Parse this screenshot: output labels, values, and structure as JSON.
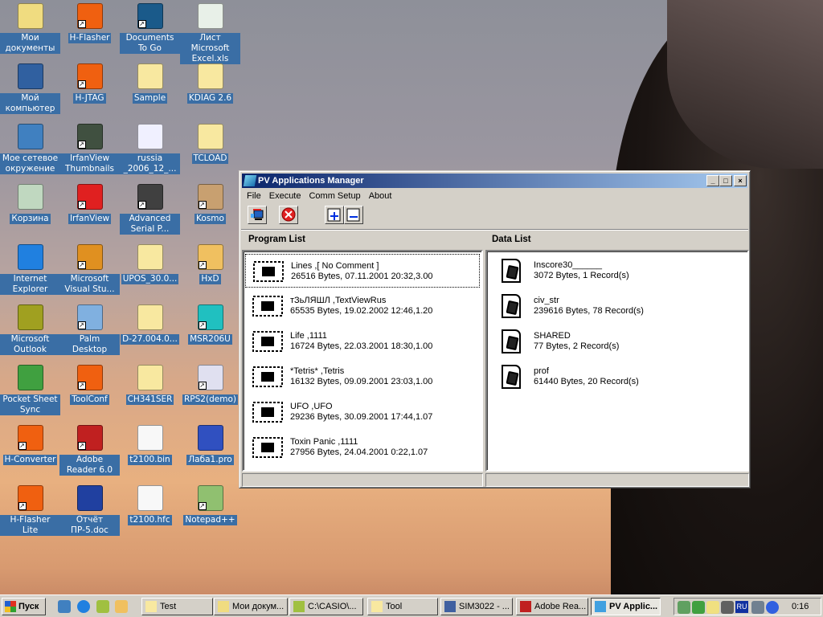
{
  "desktop_icons": [
    {
      "label": "Мои документы",
      "col": 0,
      "row": 0,
      "color": "#f0dc80",
      "shortcut": false
    },
    {
      "label": "H-Flasher",
      "col": 1,
      "row": 0,
      "color": "#f06010",
      "shortcut": true
    },
    {
      "label": "Documents To Go",
      "col": 2,
      "row": 0,
      "color": "#1a5a8a",
      "shortcut": true
    },
    {
      "label": "Лист Microsoft Excel.xls",
      "col": 3,
      "row": 0,
      "color": "#e8f0e8",
      "shortcut": false
    },
    {
      "label": "Мой компьютер",
      "col": 0,
      "row": 1,
      "color": "#3060a0",
      "shortcut": false
    },
    {
      "label": "H-JTAG",
      "col": 1,
      "row": 1,
      "color": "#f06010",
      "shortcut": true
    },
    {
      "label": "Sample",
      "col": 2,
      "row": 1,
      "color": "#f8e8a0",
      "shortcut": false
    },
    {
      "label": "KDIAG 2.6",
      "col": 3,
      "row": 1,
      "color": "#f8e8a0",
      "shortcut": false
    },
    {
      "label": "Мое сетевое окружение",
      "col": 0,
      "row": 2,
      "color": "#4080c0",
      "shortcut": false
    },
    {
      "label": "IrfanView Thumbnails",
      "col": 1,
      "row": 2,
      "color": "#405040",
      "shortcut": true
    },
    {
      "label": "russia _2006_12_...",
      "col": 2,
      "row": 2,
      "color": "#f0f0ff",
      "shortcut": false
    },
    {
      "label": "TCLOAD",
      "col": 3,
      "row": 2,
      "color": "#f8e8a0",
      "shortcut": false
    },
    {
      "label": "Корзина",
      "col": 0,
      "row": 3,
      "color": "#c0d8c0",
      "shortcut": false
    },
    {
      "label": "IrfanView",
      "col": 1,
      "row": 3,
      "color": "#e02020",
      "shortcut": true
    },
    {
      "label": "Advanced Serial P...",
      "col": 2,
      "row": 3,
      "color": "#404040",
      "shortcut": true
    },
    {
      "label": "Kosmo",
      "col": 3,
      "row": 3,
      "color": "#c8a070",
      "shortcut": true
    },
    {
      "label": "Internet Explorer",
      "col": 0,
      "row": 4,
      "color": "#2080e0",
      "shortcut": false
    },
    {
      "label": "Microsoft Visual Stu...",
      "col": 1,
      "row": 4,
      "color": "#e09020",
      "shortcut": true
    },
    {
      "label": "UPOS_30.0...",
      "col": 2,
      "row": 4,
      "color": "#f8e8a0",
      "shortcut": false
    },
    {
      "label": "HxD",
      "col": 3,
      "row": 4,
      "color": "#f0c060",
      "shortcut": true
    },
    {
      "label": "Microsoft Outlook",
      "col": 0,
      "row": 5,
      "color": "#a0a020",
      "shortcut": false
    },
    {
      "label": "Palm Desktop",
      "col": 1,
      "row": 5,
      "color": "#80b0e0",
      "shortcut": true
    },
    {
      "label": "D-27.004.0...",
      "col": 2,
      "row": 5,
      "color": "#f8e8a0",
      "shortcut": false
    },
    {
      "label": "MSR206U",
      "col": 3,
      "row": 5,
      "color": "#20c0c0",
      "shortcut": true
    },
    {
      "label": "Pocket Sheet Sync",
      "col": 0,
      "row": 6,
      "color": "#40a040",
      "shortcut": false
    },
    {
      "label": "ToolConf",
      "col": 1,
      "row": 6,
      "color": "#f06010",
      "shortcut": true
    },
    {
      "label": "CH341SER",
      "col": 2,
      "row": 6,
      "color": "#f8e8a0",
      "shortcut": false
    },
    {
      "label": "RPS2(demo)",
      "col": 3,
      "row": 6,
      "color": "#e0e0f0",
      "shortcut": true
    },
    {
      "label": "H-Converter",
      "col": 0,
      "row": 7,
      "color": "#f06010",
      "shortcut": true
    },
    {
      "label": "Adobe Reader 6.0",
      "col": 1,
      "row": 7,
      "color": "#c02020",
      "shortcut": true
    },
    {
      "label": "t2100.bin",
      "col": 2,
      "row": 7,
      "color": "#f8f8f8",
      "shortcut": false
    },
    {
      "label": "Лаба1.pro",
      "col": 3,
      "row": 7,
      "color": "#3050c0",
      "shortcut": false
    },
    {
      "label": "H-Flasher Lite",
      "col": 0,
      "row": 8,
      "color": "#f06010",
      "shortcut": true
    },
    {
      "label": "Отчёт ПР-5.doc",
      "col": 1,
      "row": 8,
      "color": "#2040a0",
      "shortcut": false
    },
    {
      "label": "t2100.hfc",
      "col": 2,
      "row": 8,
      "color": "#f8f8f8",
      "shortcut": false
    },
    {
      "label": "Notepad++",
      "col": 3,
      "row": 8,
      "color": "#90c070",
      "shortcut": true
    }
  ],
  "window": {
    "title": "PV Applications Manager",
    "menu": [
      "File",
      "Execute",
      "Comm Setup",
      "About"
    ],
    "toolbar": [
      "send-to-device-icon",
      "delete-icon",
      "expand-icon",
      "collapse-icon"
    ],
    "program_list_header": "Program List",
    "data_list_header": "Data List",
    "programs": [
      {
        "name": "Lines ,[ No Comment ]",
        "info": "26516 Bytes, 07.11.2001 20:32,3.00",
        "selected": true
      },
      {
        "name": "тЗьЛЯШЛ    ,TextViewRus",
        "info": "65535 Bytes, 19.02.2002 12:46,1.20"
      },
      {
        "name": "Life ,1111",
        "info": "16724 Bytes, 22.03.2001 18:30,1.00"
      },
      {
        "name": "*Tetris* ,Tetris",
        "info": "16132 Bytes, 09.09.2001 23:03,1.00"
      },
      {
        "name": "UFO ,UFO",
        "info": "29236 Bytes, 30.09.2001 17:44,1.07"
      },
      {
        "name": "Toxin Panic ,1111",
        "info": "27956 Bytes, 24.04.2001 0:22,1.07"
      }
    ],
    "data": [
      {
        "name": "Inscore30______",
        "info": "3072 Bytes, 1 Record(s)"
      },
      {
        "name": "civ_str",
        "info": "239616 Bytes, 78 Record(s)"
      },
      {
        "name": "SHARED",
        "info": "77 Bytes, 2 Record(s)"
      },
      {
        "name": "prof",
        "info": "61440 Bytes, 20 Record(s)"
      }
    ]
  },
  "taskbar": {
    "start": "Пуск",
    "tasks": [
      {
        "label": "Test",
        "color": "#f8e8a0"
      },
      {
        "label": "Мои докум...",
        "color": "#f0dc80"
      },
      {
        "label": "C:\\CASIO\\...",
        "color": "#a0c040"
      },
      {
        "label": "Tool",
        "color": "#f8e8a0"
      },
      {
        "label": "SIM3022 - ...",
        "color": "#4060a0"
      },
      {
        "label": "Adobe Rea...",
        "color": "#c02020"
      },
      {
        "label": "PV Applic...",
        "color": "#40a0e0",
        "active": true
      }
    ],
    "tray_lang": "RU",
    "clock": "0:16"
  }
}
